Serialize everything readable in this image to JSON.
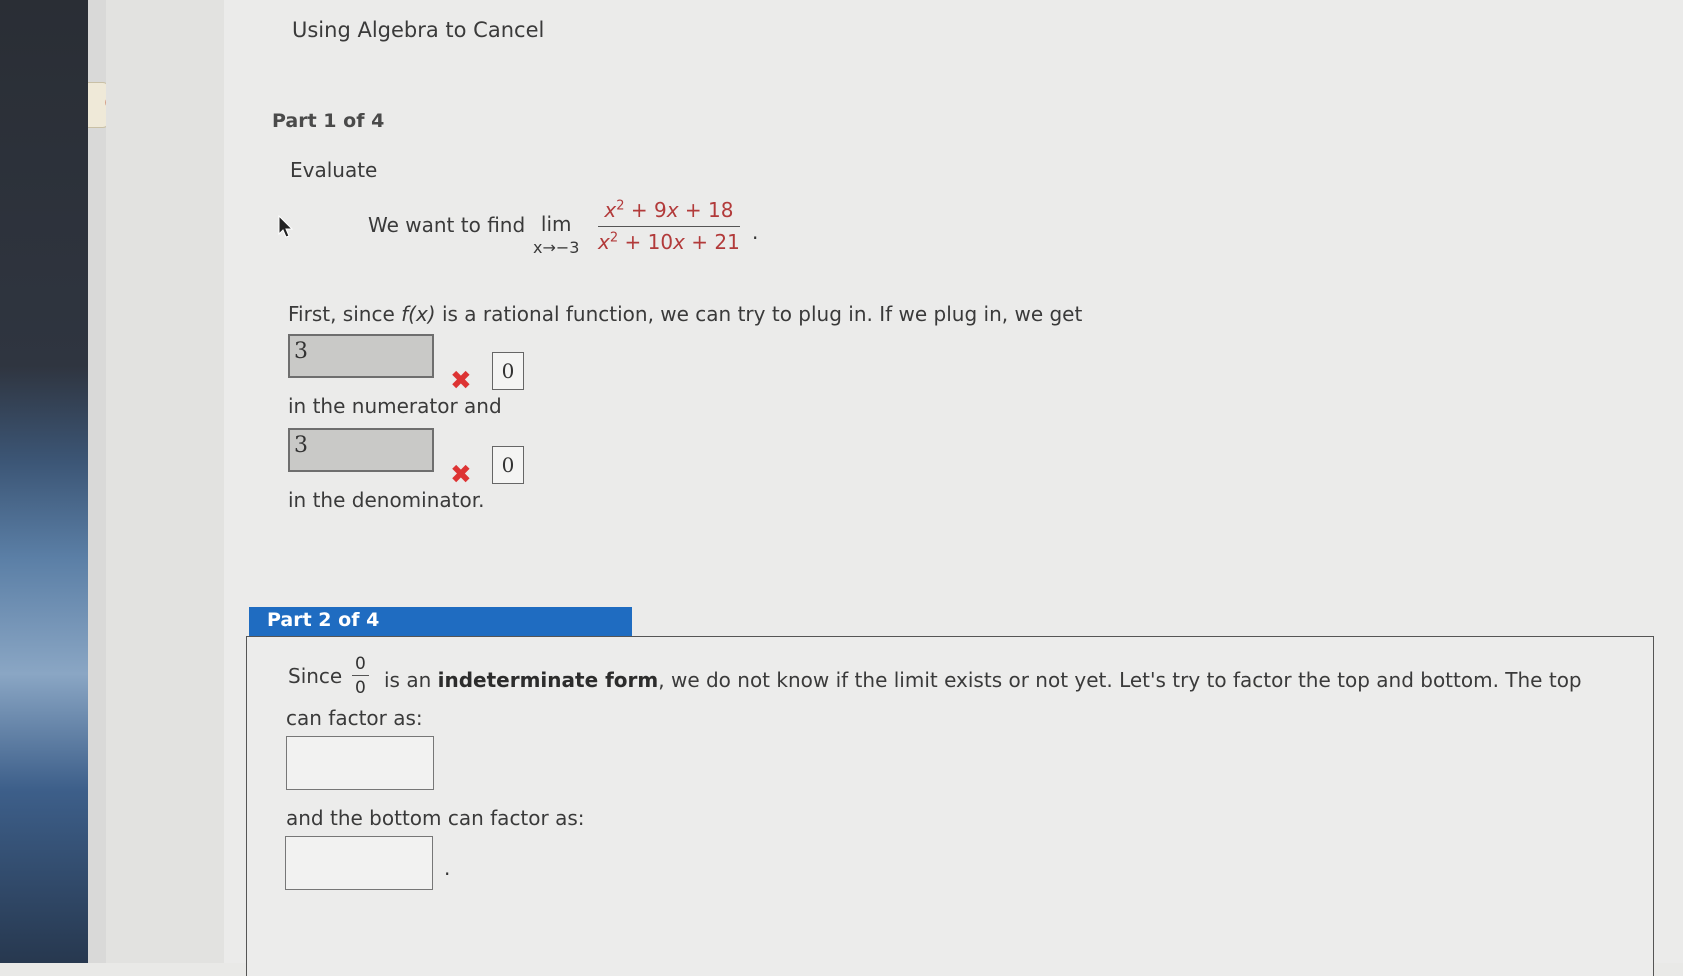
{
  "page": {
    "title": "Using Algebra to Cancel"
  },
  "part1": {
    "label": "Part 1 of 4",
    "evaluate": "Evaluate",
    "intro": "We want to find",
    "limit": {
      "word": "lim",
      "subscript": "x→−3",
      "numerator": {
        "x": "x",
        "exp": "2",
        "rest": " + 9",
        "x2": "x",
        "tail": " + 18"
      },
      "denominator": {
        "x": "x",
        "exp": "2",
        "rest": " + 10",
        "x2": "x",
        "tail": " + 21"
      },
      "period": "."
    },
    "first_since": {
      "pre": "First, since ",
      "func": "f(x)",
      "post": " is a rational function, we can try to plug in. If we plug in, we get"
    },
    "numerator_answer": "3",
    "numerator_correct": "0",
    "numerator_text": "in the numerator and",
    "denominator_answer": "3",
    "denominator_correct": "0",
    "denominator_text": "in the denominator.",
    "wrong_mark": "✖"
  },
  "part2": {
    "label": "Part 2 of 4",
    "since": "Since",
    "zero_num": "0",
    "zero_den": "0",
    "rest_pre": " is an ",
    "rest_bold": "indeterminate form",
    "rest_post": ", we do not know if the limit exists or not yet. Let's try to factor the top and bottom. The top",
    "top_factor_label": "can factor as:",
    "bottom_factor_label": "and the bottom can factor as:",
    "period": "."
  },
  "colors": {
    "header_blue": "#1f6cc1",
    "wrong_red": "#dd3333",
    "expression_red": "#b23a3a"
  },
  "icons": {
    "cursor": "mouse-pointer-icon",
    "wrong": "x-mark-icon"
  }
}
